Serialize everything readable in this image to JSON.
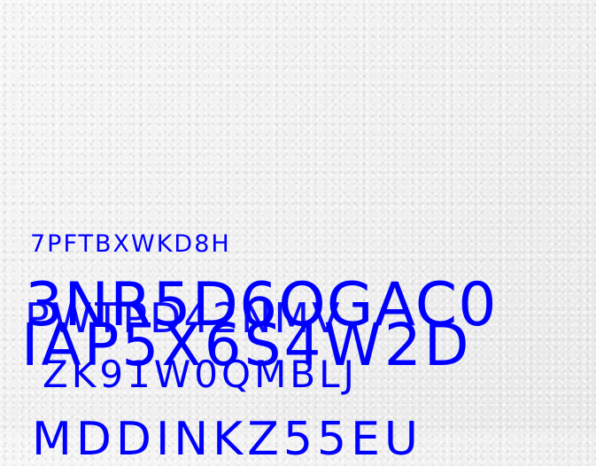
{
  "text_lines": [
    "7PFTBXWKD8H",
    "3NR5D6OGAC0",
    "PWTPD42NMV",
    "IAP5X6S4W2D",
    "ZK91W0QMBLJ",
    "MDDINKZ55EU"
  ],
  "colors": {
    "text": "#0000ff",
    "background": "#f0f0f0"
  }
}
